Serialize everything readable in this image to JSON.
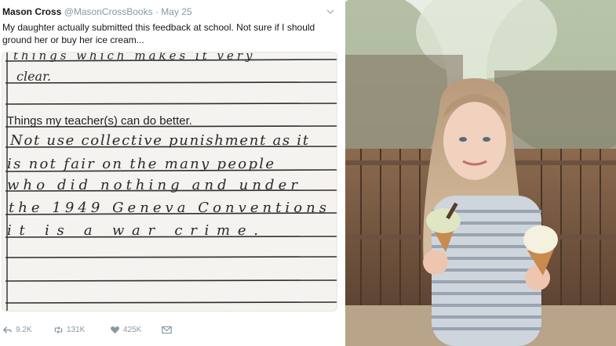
{
  "tweet": {
    "author_name": "Mason Cross",
    "handle": "@MasonCrossBooks",
    "separator": "·",
    "date": "May 25",
    "text": "My daughter actually submitted this feedback at school. Not sure if I should ground her or buy her ice cream...",
    "stats": {
      "replies": "9.2K",
      "retweets": "131K",
      "likes": "425K"
    }
  },
  "notebook": {
    "top_fragment_1": "things which makes it very",
    "top_fragment_2": "clear.",
    "heading": "Things my teacher(s)  can do better.",
    "lines": [
      "Not use collective punishment as it",
      "is not fair on the many people",
      "who did nothing and under",
      "the 1949 Geneva Conventions",
      "it is a war crime."
    ]
  },
  "icons": [
    "chevron-down-icon",
    "reply-icon",
    "retweet-icon",
    "heart-icon",
    "dm-icon"
  ],
  "colors": {
    "text": "#14171a",
    "muted": "#8899a6",
    "paper": "#f3f2ee",
    "rule": "#2b2b2b",
    "ink": "#2a2a2a"
  }
}
